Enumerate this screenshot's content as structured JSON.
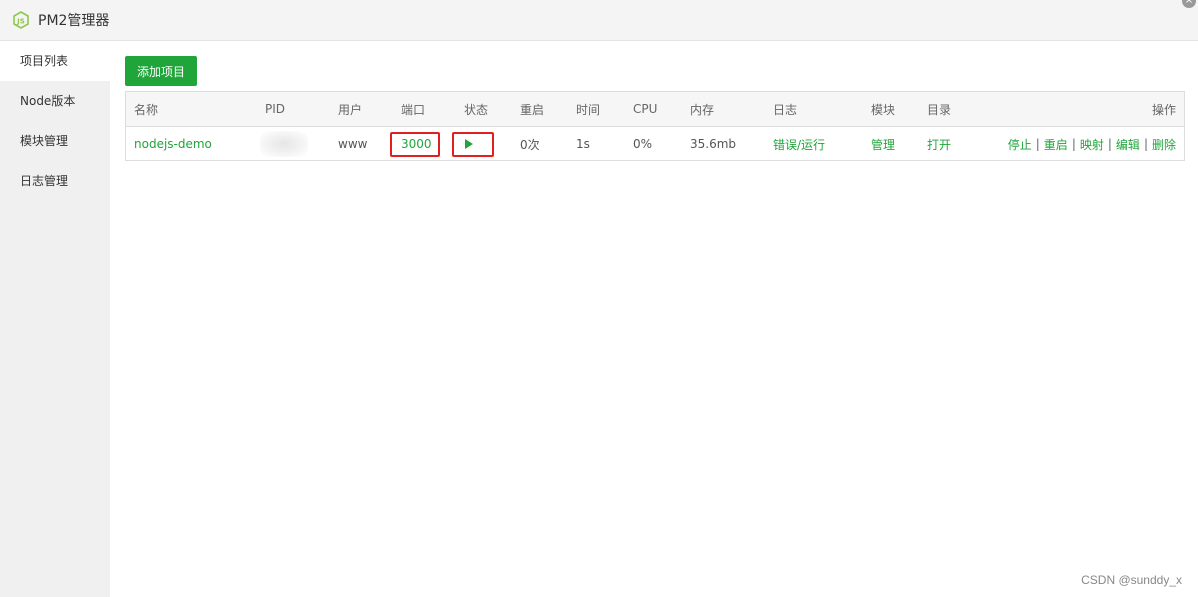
{
  "window": {
    "title": "PM2管理器",
    "close_symbol": "×"
  },
  "sidebar": {
    "items": [
      {
        "label": "项目列表",
        "active": true
      },
      {
        "label": "Node版本",
        "active": false
      },
      {
        "label": "模块管理",
        "active": false
      },
      {
        "label": "日志管理",
        "active": false
      }
    ]
  },
  "toolbar": {
    "add_label": "添加项目"
  },
  "table": {
    "headers": {
      "name": "名称",
      "pid": "PID",
      "user": "用户",
      "port": "端口",
      "status": "状态",
      "restart": "重启",
      "time": "时间",
      "cpu": "CPU",
      "memory": "内存",
      "log": "日志",
      "module": "模块",
      "dir": "目录",
      "ops": "操作"
    },
    "rows": [
      {
        "name": "nodejs-demo",
        "pid": "",
        "user": "www",
        "port": "3000",
        "status": "running",
        "restart": "0次",
        "time": "1s",
        "cpu": "0%",
        "memory": "35.6mb",
        "log": "错误/运行",
        "module": "管理",
        "dir": "打开",
        "ops": {
          "stop": "停止",
          "restart": "重启",
          "map": "映射",
          "edit": "编辑",
          "delete": "删除"
        }
      }
    ]
  },
  "colors": {
    "accent": "#20a53a",
    "highlight": "#e02020"
  },
  "watermark": "CSDN @sunddy_x"
}
